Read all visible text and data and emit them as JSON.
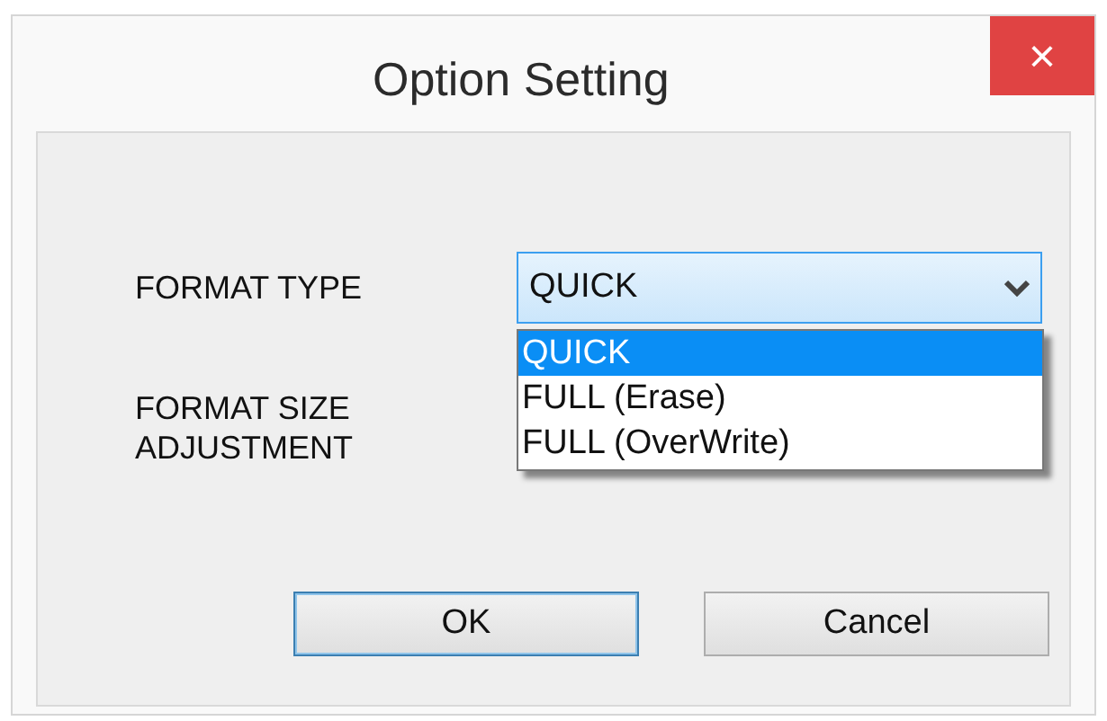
{
  "window": {
    "title": "Option Setting",
    "close": "×"
  },
  "fields": [
    {
      "label": "FORMAT TYPE",
      "value": "QUICK",
      "expanded": true,
      "options": [
        {
          "label": "QUICK",
          "selected": true
        },
        {
          "label": "FULL (Erase)",
          "selected": false
        },
        {
          "label": "FULL (OverWrite)",
          "selected": false
        }
      ]
    },
    {
      "label": "FORMAT SIZE\nADJUSTMENT"
    }
  ],
  "buttons": [
    "OK",
    "Cancel"
  ]
}
